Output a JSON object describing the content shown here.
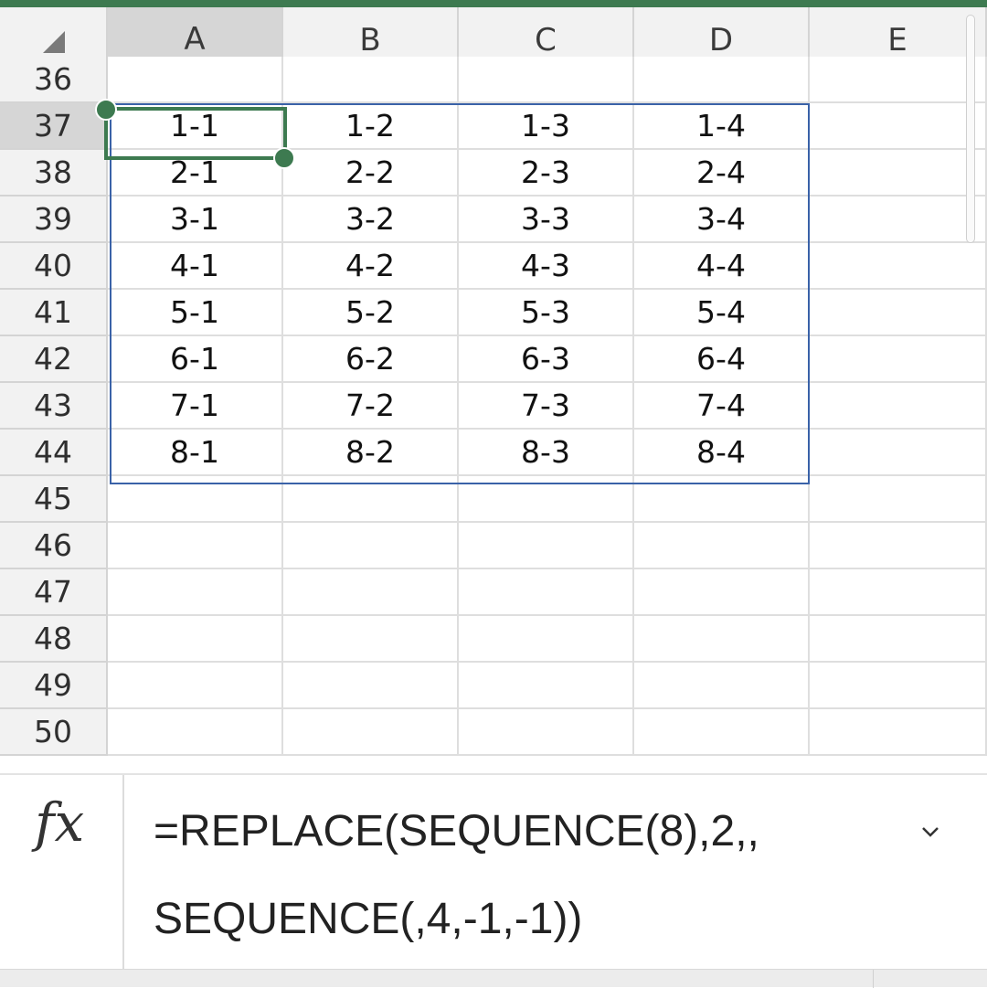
{
  "app": {
    "accent_color": "#3d7a50",
    "spill_border_color": "#3a62a8"
  },
  "columns": [
    "A",
    "B",
    "C",
    "D",
    "E"
  ],
  "active_column": "A",
  "rows": [
    "36",
    "37",
    "38",
    "39",
    "40",
    "41",
    "42",
    "43",
    "44",
    "45",
    "46",
    "47",
    "48",
    "49",
    "50"
  ],
  "active_row": "37",
  "cells": [
    [
      "",
      "",
      "",
      "",
      ""
    ],
    [
      "1-1",
      "1-2",
      "1-3",
      "1-4",
      ""
    ],
    [
      "2-1",
      "2-2",
      "2-3",
      "2-4",
      ""
    ],
    [
      "3-1",
      "3-2",
      "3-3",
      "3-4",
      ""
    ],
    [
      "4-1",
      "4-2",
      "4-3",
      "4-4",
      ""
    ],
    [
      "5-1",
      "5-2",
      "5-3",
      "5-4",
      ""
    ],
    [
      "6-1",
      "6-2",
      "6-3",
      "6-4",
      ""
    ],
    [
      "7-1",
      "7-2",
      "7-3",
      "7-4",
      ""
    ],
    [
      "8-1",
      "8-2",
      "8-3",
      "8-4",
      ""
    ],
    [
      "",
      "",
      "",
      "",
      ""
    ],
    [
      "",
      "",
      "",
      "",
      ""
    ],
    [
      "",
      "",
      "",
      "",
      ""
    ],
    [
      "",
      "",
      "",
      "",
      ""
    ],
    [
      "",
      "",
      "",
      "",
      ""
    ],
    [
      "",
      "",
      "",
      "",
      ""
    ]
  ],
  "formula_bar": {
    "fx_label": "fx",
    "formula_line1": "=REPLACE(SEQUENCE(8),2,,",
    "formula_line2": "SEQUENCE(,4,-1,-1))",
    "expand_icon": "chevron-down-icon"
  }
}
